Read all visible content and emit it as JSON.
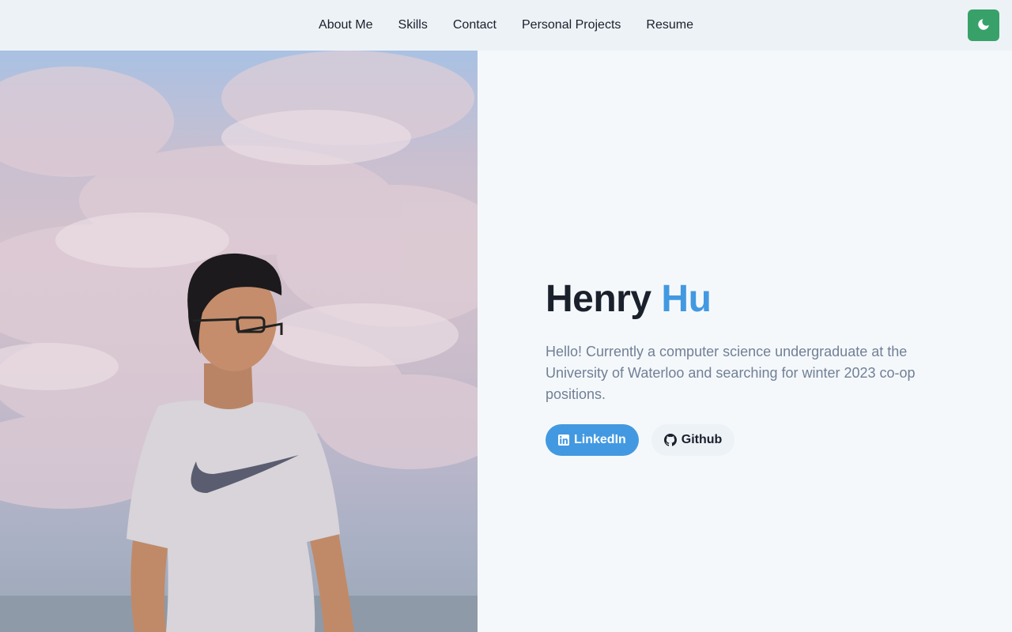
{
  "nav": {
    "items": [
      {
        "label": "About Me"
      },
      {
        "label": "Skills"
      },
      {
        "label": "Contact"
      },
      {
        "label": "Personal Projects"
      },
      {
        "label": "Resume"
      }
    ],
    "theme_toggle_icon": "moon-icon"
  },
  "hero": {
    "first_name": "Henry",
    "last_name": "Hu",
    "bio": "Hello! Currently a computer science undergraduate at the University of Waterloo and searching for winter 2023 co-op positions.",
    "buttons": {
      "linkedin": {
        "label": "LinkedIn",
        "icon": "linkedin-icon"
      },
      "github": {
        "label": "Github",
        "icon": "github-icon"
      }
    }
  },
  "colors": {
    "accent": "#4299e1",
    "toggle": "#38a169",
    "nav_bg": "#edf2f7",
    "page_bg": "#f5f8fb"
  }
}
